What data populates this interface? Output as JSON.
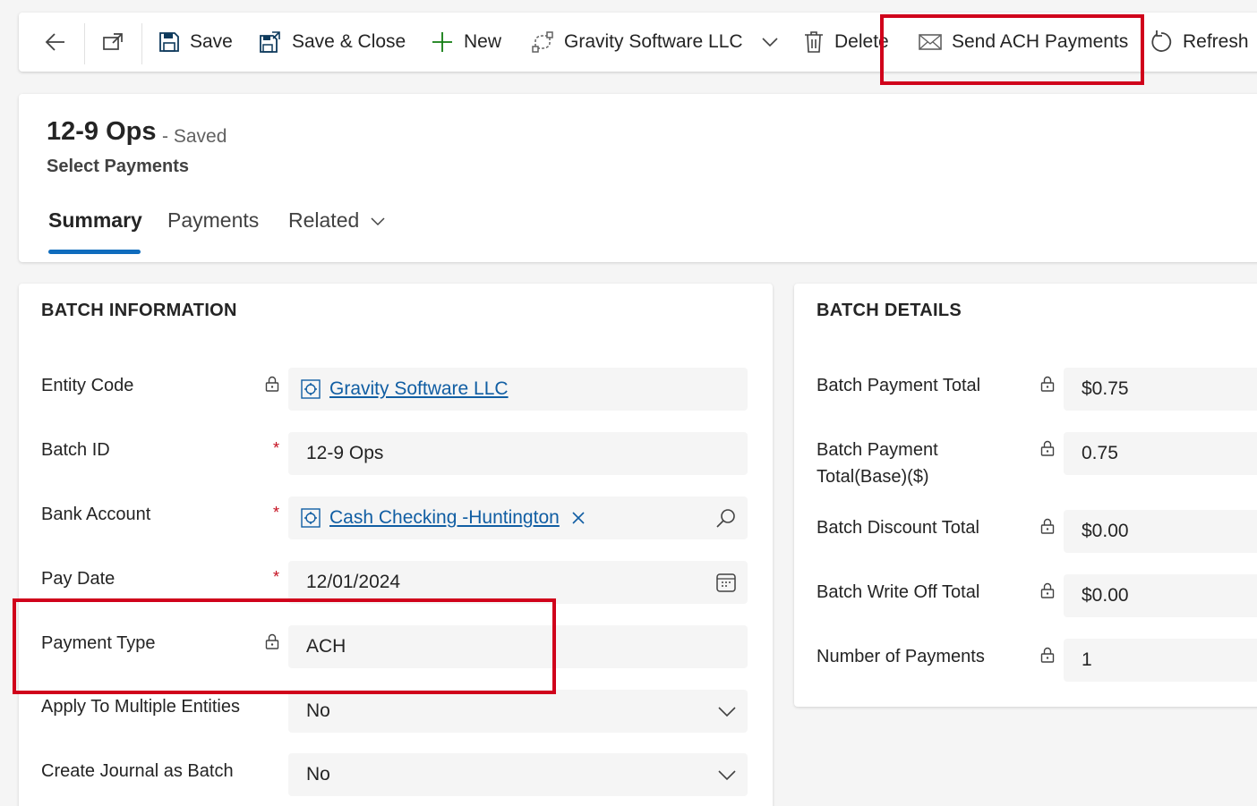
{
  "toolbar": {
    "save_label": "Save",
    "save_close_label": "Save & Close",
    "new_label": "New",
    "entity_label": "Gravity Software LLC",
    "delete_label": "Delete",
    "send_ach_label": "Send ACH Payments",
    "refresh_label": "Refresh"
  },
  "header": {
    "title": "12-9 Ops",
    "status": "- Saved",
    "subtitle": "Select Payments",
    "tabs": [
      {
        "label": "Summary",
        "active": true
      },
      {
        "label": "Payments",
        "active": false
      },
      {
        "label": "Related",
        "active": false
      }
    ]
  },
  "batch_info": {
    "title": "BATCH INFORMATION",
    "fields": [
      {
        "label": "Entity Code",
        "value": "Gravity Software LLC",
        "kind": "locked-lookup"
      },
      {
        "label": "Batch ID",
        "value": "12-9 Ops",
        "kind": "required-text"
      },
      {
        "label": "Bank Account",
        "value": "Cash Checking -Huntington",
        "kind": "required-lookup"
      },
      {
        "label": "Pay Date",
        "value": "12/01/2024",
        "kind": "required-date"
      },
      {
        "label": "Payment Type",
        "value": "ACH",
        "kind": "locked-text"
      },
      {
        "label": "Apply To Multiple Entities",
        "value": "No",
        "kind": "select"
      },
      {
        "label": "Create Journal as Batch",
        "value": "No",
        "kind": "select"
      }
    ]
  },
  "batch_details": {
    "title": "BATCH DETAILS",
    "fields": [
      {
        "label": "Batch Payment Total",
        "value": "$0.75"
      },
      {
        "label": "Batch Payment Total(Base)($)",
        "label_line1": "Batch Payment",
        "label_line2": "Total(Base)($)",
        "value": "0.75"
      },
      {
        "label": "Batch Discount Total",
        "value": "$0.00"
      },
      {
        "label": "Batch Write Off Total",
        "value": "$0.00"
      },
      {
        "label": "Number of Payments",
        "value": "1"
      }
    ]
  },
  "required_marker": "*",
  "colors": {
    "accent": "#0f6cbd",
    "link": "#115ea3",
    "highlight": "#d0021b",
    "required": "#c50f1f",
    "new_icon": "#107c10"
  },
  "icons": [
    "back-arrow-icon",
    "open-new-window-icon",
    "save-icon",
    "save-close-icon",
    "plus-icon",
    "flow-icon",
    "chevron-down-icon",
    "trash-icon",
    "mail-icon",
    "refresh-icon",
    "lock-icon",
    "entity-record-icon",
    "search-icon",
    "calendar-icon",
    "clear-x-icon"
  ]
}
